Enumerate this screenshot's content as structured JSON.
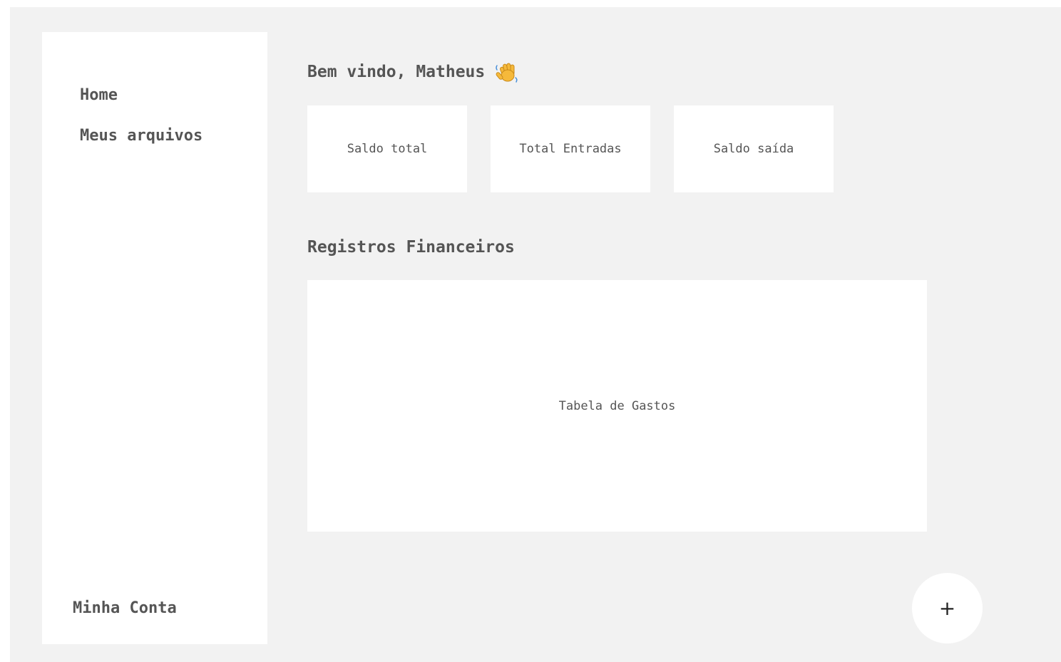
{
  "sidebar": {
    "items": [
      {
        "label": "Home"
      },
      {
        "label": "Meus arquivos"
      }
    ],
    "account_label": "Minha Conta"
  },
  "header": {
    "greeting": "Bem vindo, Matheus",
    "greeting_icon": "waving-hand-icon"
  },
  "summary_cards": [
    {
      "label": "Saldo total"
    },
    {
      "label": "Total Entradas"
    },
    {
      "label": "Saldo saída"
    }
  ],
  "records": {
    "title": "Registros Financeiros",
    "table_placeholder": "Tabela de Gastos"
  },
  "fab": {
    "label": "+"
  },
  "colors": {
    "background": "#f2f2f2",
    "panel": "#ffffff",
    "text": "#555555"
  }
}
